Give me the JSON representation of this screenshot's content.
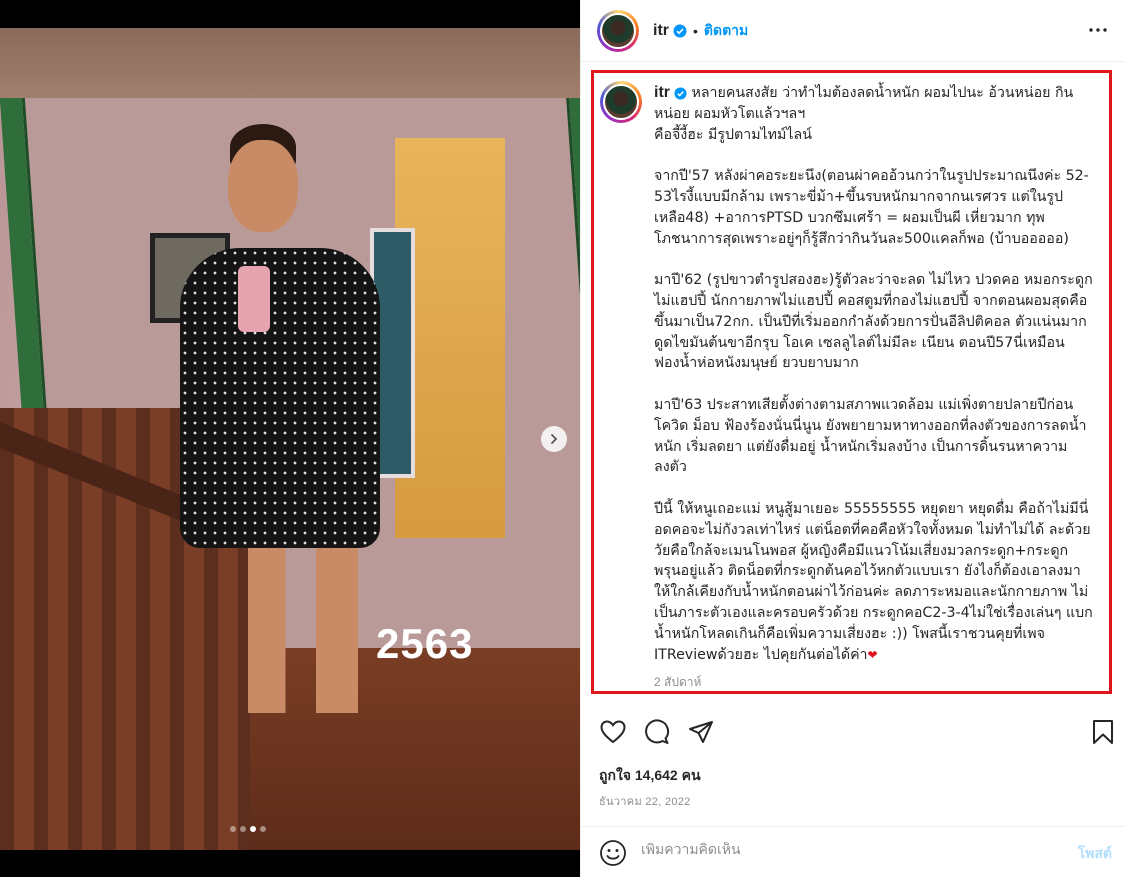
{
  "post": {
    "photo_overlay_text": "2563",
    "carousel": {
      "total": 4,
      "active_index": 2
    }
  },
  "header": {
    "username": "itr",
    "separator": "•",
    "follow_label": "ติดตาม",
    "verified_icon": "verified-badge-icon",
    "more_icon": "more-options-icon"
  },
  "caption": {
    "username": "itr",
    "text": "หลายคนสงสัย ว่าทำไมต้องลดน้ำหนัก ผอมไปนะ อ้วนหน่อย กินหน่อย ผอมหัวโตแล้วฯลฯ\nคือจี้งี้ฮะ มีรูปตามไทม์ไลน์\n\nจากปี'57 หลังผ่าคอระยะนึง(ตอนผ่าคออ้วนกว่าในรูปประมาณนึงค่ะ 52-53ไรงี้แบบมีกล้าม เพราะขี่ม้า+ขึ้นรบหนักมากจากนเรศวร แต่ในรูปเหลือ48) +อาการPTSD บวกซึมเศร้า = ผอมเป็นผี เหี่ยวมาก ทุพโภชนาการสุดเพราะอยู่ๆก็รู้สึกว่ากินวันละ500แคลก็พอ (บ้าบอออออ)\n\nมาปี'62 (รูปขาวตำรูปสองฮะ)รู้ตัวละว่าจะลด ไม่ไหว ปวดคอ หมอกระดูกไม่แฮปปี้ นักกายภาพไม่แฮปปี้ คอสตูมที่กองไม่แฮปปี้ จากตอนผอมสุดคือขึ้นมาเป็น72กก. เป็นปีที่เริ่มออกกำลังด้วยการปั่นอีลิปติคอล ตัวแน่นมาก ดูดไขมันต้นขาอีกรุบ โอเค เซลลูไลต์ไม่มีละ เนียน ตอนปี57นี่เหมือนฟองน้ำห่อหนังมนุษย์ ยวบยาบมาก\n\nมาปี'63 ประสาทเสียตั้งต่างตามสภาพแวดล้อม แม่เพิ่งตายปลายปีก่อน โควิด ม็อบ ฟ้องร้องนั่นนี่นูน ยังพยายามหาทางออกที่ลงตัวของการลดน้ำหนัก เริ่มลดยา แต่ยังดื่มอยู่ น้ำหนักเริ่มลงบ้าง เป็นการดิ้นรนหาความลงตัว\n\nปีนี้ ให้หนูเถอะแม่ หนูสู้มาเยอะ 55555555 หยุดยา หยุดดื่ม คือถ้าไม่มีนี่อดคอจะไม่กังวลเท่าไหร่ แต่น็อตที่คอคือหัวใจทั้งหมด ไม่ทำไม่ได้ ละด้วยวัยคือใกล้จะเมนโนพอส ผู้หญิงคือมีแนวโน้มเสี่ยงมวลกระดูก+กระดูกพรุนอยู่แล้ว ติดน็อตที่กระดูกต้นคอไว้หกตัวแบบเรา ยังไงก็ต้องเอาลงมาให้ใกล้เคียงกับน้ำหนักตอนผ่าไว้ก่อนค่ะ ลดภาระหมอและนักกายภาพ ไม่เป็นภาระตัวเองและครอบครัวด้วย กระดูกคอC2-3-4ไม่ใช่เรื่องเล่นๆ แบกน้ำหนักโหลดเกินก็คือเพิ่มความเสี่ยงฮะ :)) โพสนี้เราชวนคุยที่เพจ ITReviewด้วยฮะ ไปคุยกันต่อได้ค่า",
    "heart_emoji": "❤",
    "time_ago": "2 สัปดาห์"
  },
  "actions": {
    "like_icon": "heart-icon",
    "comment_icon": "comment-icon",
    "share_icon": "share-icon",
    "save_icon": "bookmark-icon"
  },
  "stats": {
    "likes_text": "ถูกใจ 14,642 คน",
    "date_text": "ธันวาคม 22, 2022"
  },
  "comment": {
    "placeholder": "เพิ่มความคิดเห็น",
    "post_label": "โพสต์",
    "emoji_icon": "emoji-icon"
  },
  "colors": {
    "accent_blue": "#0095f6",
    "highlight_red": "#e0161e",
    "post_disabled": "#b2dffc"
  }
}
